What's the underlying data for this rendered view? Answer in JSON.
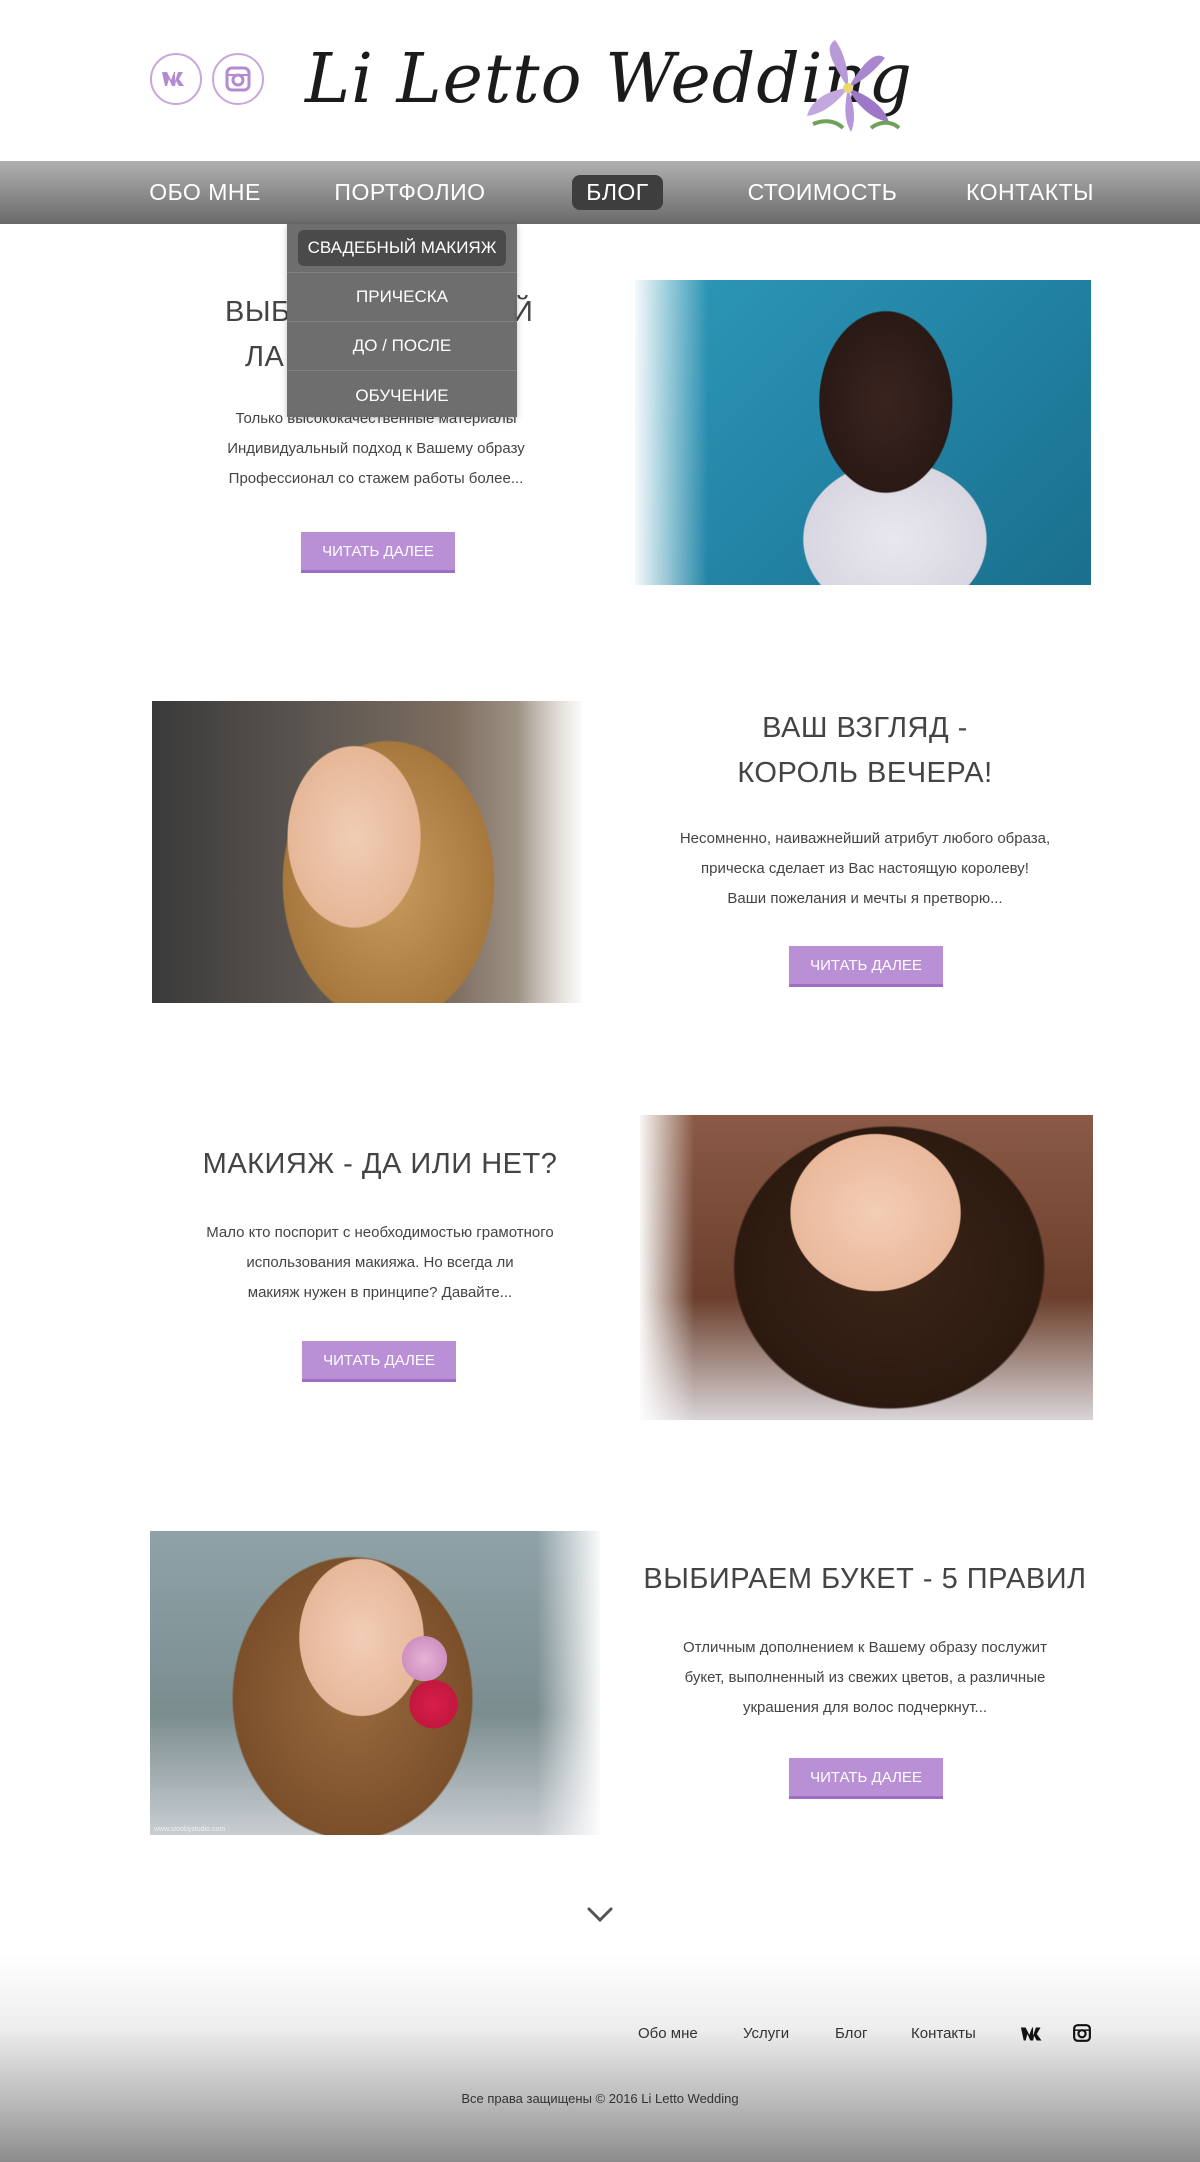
{
  "header": {
    "logo_text": "Li Letto Wedding",
    "social": [
      {
        "icon": "vk-icon"
      },
      {
        "icon": "instagram-icon"
      }
    ]
  },
  "nav": {
    "items": [
      "ОБО МНЕ",
      "ПОРТФОЛИО",
      "БЛОГ",
      "СТОИМОСТЬ",
      "КОНТАКТЫ"
    ],
    "active": "БЛОГ"
  },
  "dropdown": {
    "items": [
      "СВАДЕБНЫЙ МАКИЯЖ",
      "ПРИЧЕСКА",
      "ДО / ПОСЛЕ",
      "ОБУЧЕНИЕ"
    ],
    "highlighted": "СВАДЕБНЫЙ МАКИЯЖ"
  },
  "posts": [
    {
      "title_lines": [
        "ВЫБ",
        "ЛА"
      ],
      "title_tail": [
        "Й",
        ""
      ],
      "text_lines": [
        "Только высококачественные материалы",
        "Индивидуальный подход к Вашему образу",
        "Профессионал со стажем работы более..."
      ],
      "button": "ЧИТАТЬ ДАЛЕЕ"
    },
    {
      "title_lines": [
        "ВАШ ВЗГЛЯД -",
        "КОРОЛЬ ВЕЧЕРА!"
      ],
      "text_lines": [
        "Несомненно, наиважнейший атрибут любого образа,",
        "прическа сделает из Вас настоящую королеву!",
        "Ваши пожелания и мечты я претворю..."
      ],
      "button": "ЧИТАТЬ ДАЛЕЕ"
    },
    {
      "title_lines": [
        "МАКИЯЖ - ДА ИЛИ НЕТ?"
      ],
      "text_lines": [
        "Мало кто поспорит с необходимостью грамотного",
        "использования макияжа. Но всегда ли",
        "макияж нужен в принципе? Давайте..."
      ],
      "button": "ЧИТАТЬ ДАЛЕЕ"
    },
    {
      "title_lines": [
        "ВЫБИРАЕМ БУКЕТ - 5 ПРАВИЛ"
      ],
      "text_lines": [
        "Отличным дополнением к Вашему образу послужит",
        "букет, выполненный из свежих цветов, а различные",
        "украшения для волос подчеркнут..."
      ],
      "button": "ЧИТАТЬ ДАЛЕЕ",
      "photo_watermark": "www.stoobystudio.com"
    }
  ],
  "scroll_icon": "chevron-down-icon",
  "footer": {
    "links": [
      "Обо мне",
      "Услуги",
      "Блог",
      "Контакты"
    ],
    "copyright": "Все права защищены © 2016 Li Letto Wedding",
    "icons": [
      "vk-icon",
      "instagram-icon"
    ]
  },
  "colors": {
    "accent": "#b98fd6",
    "nav_bg": "#8a8a8a",
    "dropdown_bg": "#696969"
  }
}
